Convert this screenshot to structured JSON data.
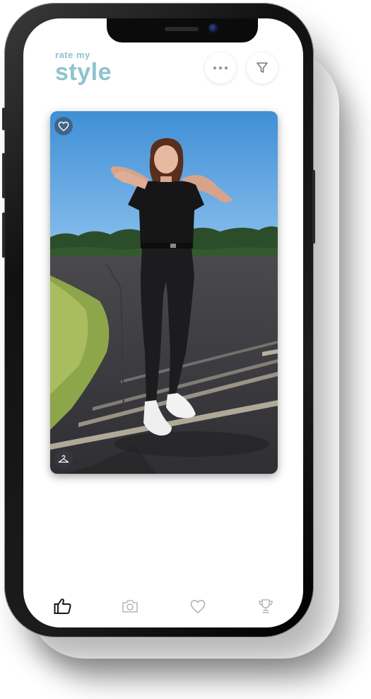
{
  "app": {
    "logo_small": "rate my",
    "logo_big": "style",
    "accent_color": "#8ec3cc"
  },
  "header": {
    "more_button": {
      "icon": "more-horizontal-icon"
    },
    "filter_button": {
      "icon": "filter-icon"
    }
  },
  "card": {
    "favorite_icon": "heart-icon",
    "category_icon": "hanger-icon"
  },
  "tabs": [
    {
      "name": "rate",
      "icon": "thumbs-up-icon",
      "active": true
    },
    {
      "name": "upload",
      "icon": "camera-icon",
      "active": false
    },
    {
      "name": "favorites",
      "icon": "heart-icon",
      "active": false
    },
    {
      "name": "ranking",
      "icon": "trophy-icon",
      "active": false
    }
  ],
  "colors": {
    "active_tab": "#1a1a1a",
    "inactive_tab": "#b8b8b8"
  }
}
